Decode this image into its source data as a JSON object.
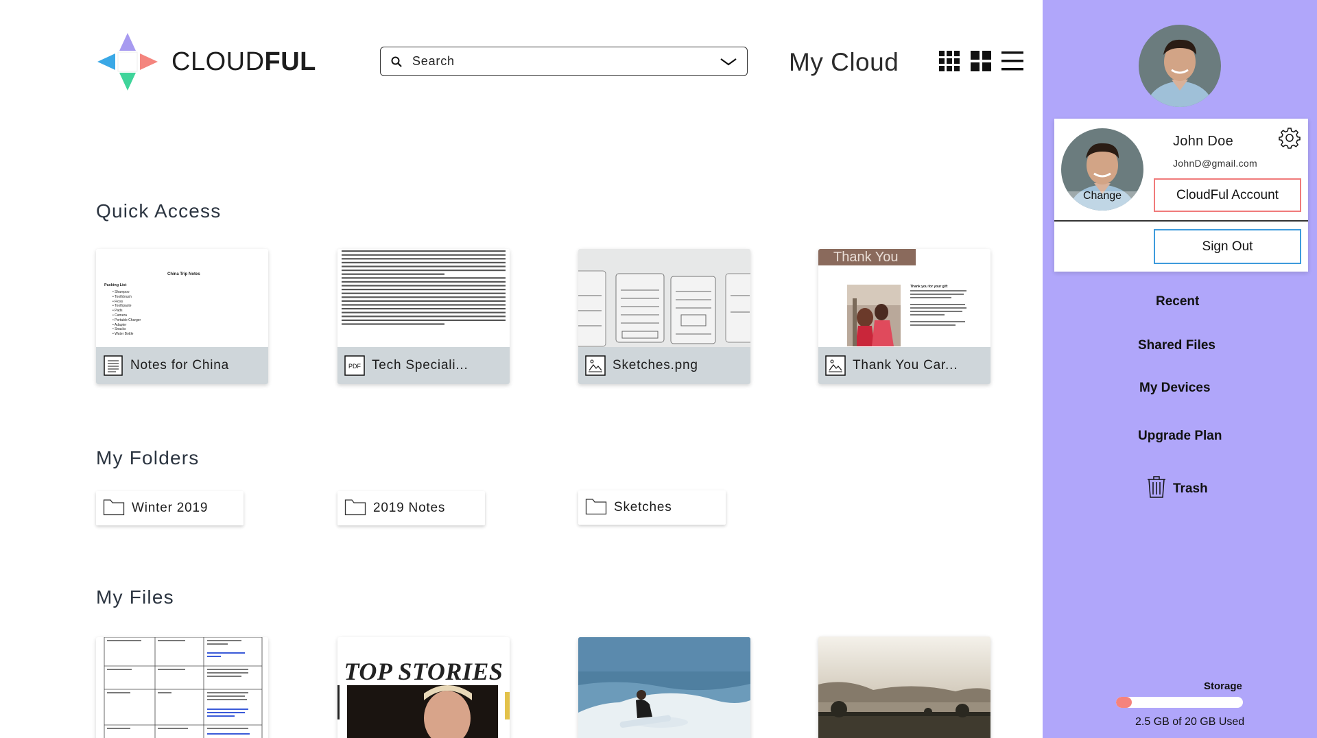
{
  "app": {
    "logo_text_light": "CLOUD",
    "logo_text_bold": "FUL",
    "page_title": "My Cloud"
  },
  "search": {
    "placeholder": "Search"
  },
  "icons": {
    "search": "search-icon",
    "dropdown": "chevron-down-icon",
    "view_small_grid": "small-grid-view-icon",
    "view_large_grid": "large-grid-view-icon",
    "view_list": "list-view-icon",
    "settings": "gear-icon",
    "trash": "trash-icon"
  },
  "sections": {
    "quick_access": "Quick Access",
    "my_folders": "My Folders",
    "my_files": "My Files"
  },
  "quick_access": [
    {
      "name": "Notes for China",
      "type": "doc"
    },
    {
      "name": "Tech Speciali...",
      "type": "pdf"
    },
    {
      "name": "Sketches.png",
      "type": "image"
    },
    {
      "name": "Thank You Car...",
      "type": "image"
    }
  ],
  "thumbnails": {
    "notes_title": "China Trip Notes",
    "notes_heading": "Packing List",
    "notes_items": [
      "Shampoo",
      "Toothbrush",
      "Floss",
      "Toothpaste",
      "Pads",
      "Camera",
      "Portable Charger",
      "Adapter",
      "Snacks",
      "Water Bottle"
    ],
    "thank_you_banner": "Thank You",
    "thank_you_heading": "Thank you for your gift",
    "top_stories": "TOP STORIES"
  },
  "folders": [
    {
      "name": "Winter 2019"
    },
    {
      "name": "2019 Notes"
    },
    {
      "name": "Sketches"
    }
  ],
  "user": {
    "name": "John Doe",
    "email": "JohnD@gmail.com",
    "change_label": "Change",
    "account_button": "CloudFul Account",
    "signout_button": "Sign Out"
  },
  "nav": {
    "recent": "Recent",
    "shared": "Shared Files",
    "devices": "My Devices",
    "upgrade": "Upgrade Plan",
    "trash": "Trash"
  },
  "storage": {
    "label": "Storage",
    "used_text": "2.5 GB of 20 GB Used",
    "used_fraction": 0.125
  },
  "colors": {
    "sidebar_bg": "#b0a6fa",
    "caption_bg": "#cfd6da",
    "account_border": "#f07a7a",
    "signout_border": "#3d9bdc",
    "storage_fill": "#f5837d"
  }
}
